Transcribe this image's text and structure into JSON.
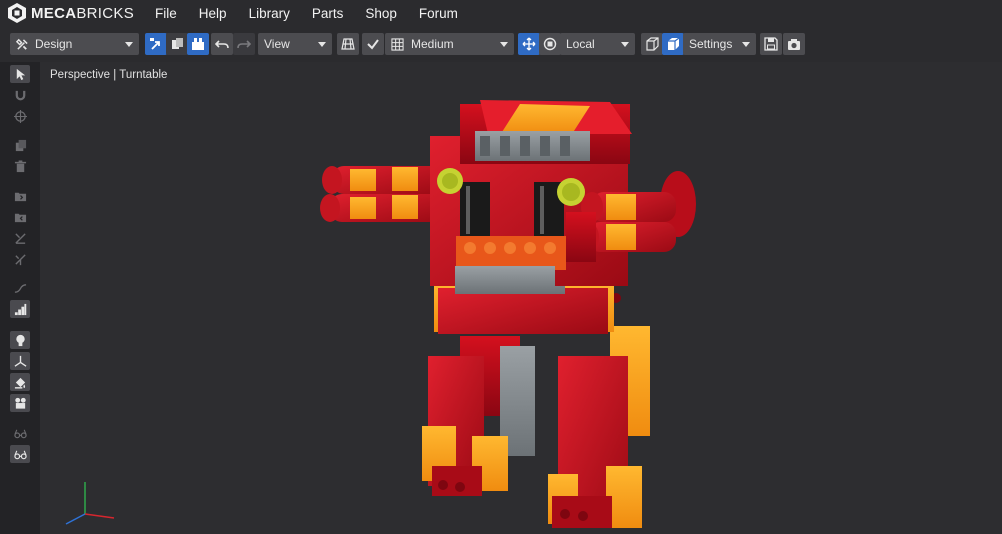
{
  "app": {
    "logo_bold": "MECA",
    "logo_light": "BRICKS"
  },
  "menu": [
    "File",
    "Help",
    "Library",
    "Parts",
    "Shop",
    "Forum"
  ],
  "toolbar": {
    "mode_select": "Design",
    "view_select": "View",
    "quality_select": "Medium",
    "space_select": "Local",
    "settings_select": "Settings"
  },
  "viewport": {
    "label": "Perspective | Turntable"
  },
  "colors": {
    "accent": "#2f6bc4",
    "brick_red": "#c4101d",
    "brick_orange": "#f9a21b",
    "brick_gray": "#8a8f93"
  },
  "sidebar_icons": [
    "select-arrow-icon",
    "magnet-icon",
    "target-icon",
    "clone-icon",
    "trash-icon",
    "group-in-icon",
    "group-out-icon",
    "hinge-icon",
    "joint-icon",
    "flexible-icon",
    "stairs-icon",
    "light-bulb-icon",
    "axes-gizmo-icon",
    "paint-bucket-icon",
    "camera-icon",
    "glasses-icon",
    "glasses-outline-icon"
  ]
}
